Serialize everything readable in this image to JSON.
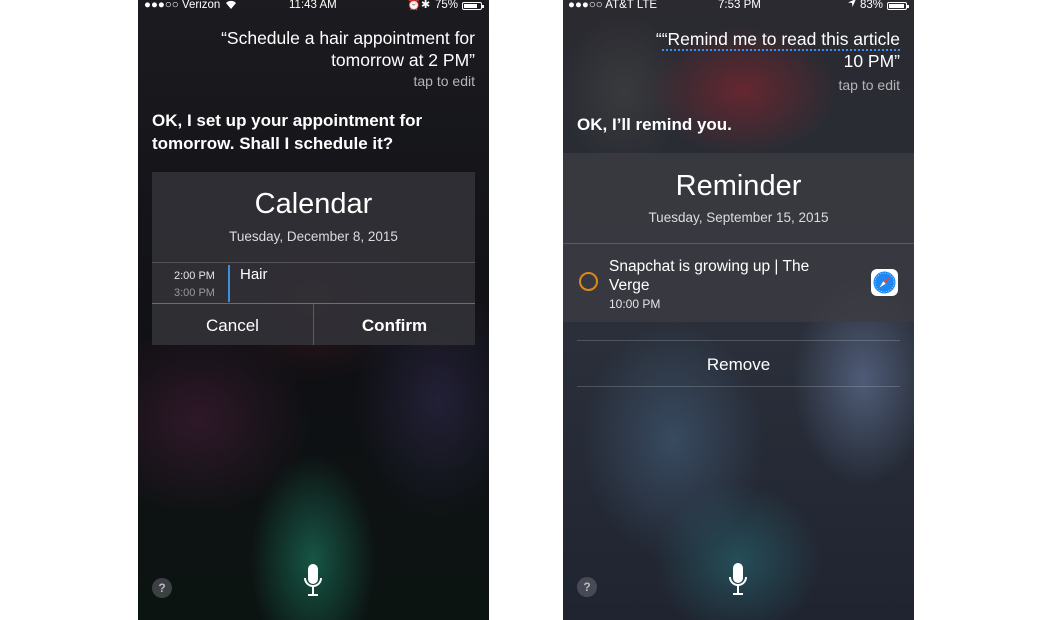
{
  "left_screen": {
    "status_bar": {
      "carrier": "●●●○○ Verizon",
      "time": "11:43 AM",
      "battery": "75%",
      "battery_level": 0.75
    },
    "query": {
      "line1": "“Schedule a hair appointment for",
      "line2": "tomorrow at 2 PM”",
      "tap_to_edit": "tap to edit"
    },
    "response": {
      "line1": "OK, I set up your appointment for",
      "line2": "tomorrow. Shall I schedule it?"
    },
    "calendar_card": {
      "title": "Calendar",
      "date": "Tuesday, December 8, 2015",
      "event": {
        "start": "2:00 PM",
        "end": "3:00 PM",
        "name": "Hair",
        "accent_color": "#3b8fe0"
      },
      "cancel_label": "Cancel",
      "confirm_label": "Confirm"
    },
    "help_label": "?"
  },
  "right_screen": {
    "status_bar": {
      "carrier": "●●●○○ AT&T  LTE",
      "time": "7:53 PM",
      "battery": "83%",
      "battery_level": 0.83
    },
    "query": {
      "line1": "“Remind me to read this article",
      "line2": "10 PM”",
      "tap_to_edit": "tap to edit"
    },
    "response": {
      "line1": "OK, I’ll remind you."
    },
    "reminder_card": {
      "title": "Reminder",
      "date": "Tuesday, September 15, 2015",
      "item": {
        "title_line1": "Snapchat is growing up | The",
        "title_line2": "Verge",
        "time": "10:00 PM",
        "circle_color": "#d98a1c",
        "app_icon": "safari-icon"
      },
      "remove_label": "Remove"
    },
    "help_label": "?"
  }
}
